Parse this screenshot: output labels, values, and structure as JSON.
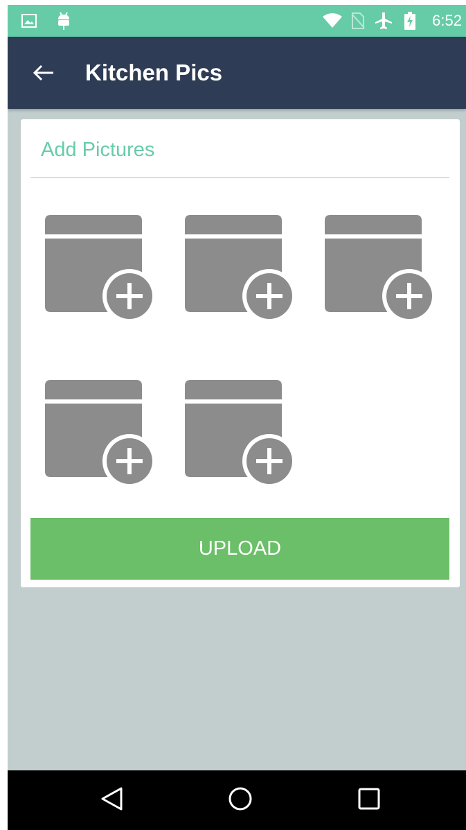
{
  "status_bar": {
    "time": "6:52",
    "icons": [
      "gallery-icon",
      "android-debug-icon",
      "wifi-icon",
      "no-sim-icon",
      "airplane-icon",
      "battery-charging-icon"
    ]
  },
  "toolbar": {
    "back_icon": "arrow-back-icon",
    "title": "Kitchen Pics"
  },
  "card": {
    "header": "Add Pictures",
    "picture_slots": [
      {
        "icon": "add-photo-icon"
      },
      {
        "icon": "add-photo-icon"
      },
      {
        "icon": "add-photo-icon"
      },
      {
        "icon": "add-photo-icon"
      },
      {
        "icon": "add-photo-icon"
      }
    ],
    "upload_label": "UPLOAD"
  },
  "nav_bar": {
    "buttons": [
      "back-triangle-icon",
      "home-circle-icon",
      "recents-square-icon"
    ]
  },
  "colors": {
    "status_bar": "#66cca8",
    "toolbar": "#2e3c55",
    "background": "#c2cecd",
    "accent": "#66cca8",
    "upload_button": "#6bbf68",
    "placeholder_icon": "#8c8c8c"
  }
}
